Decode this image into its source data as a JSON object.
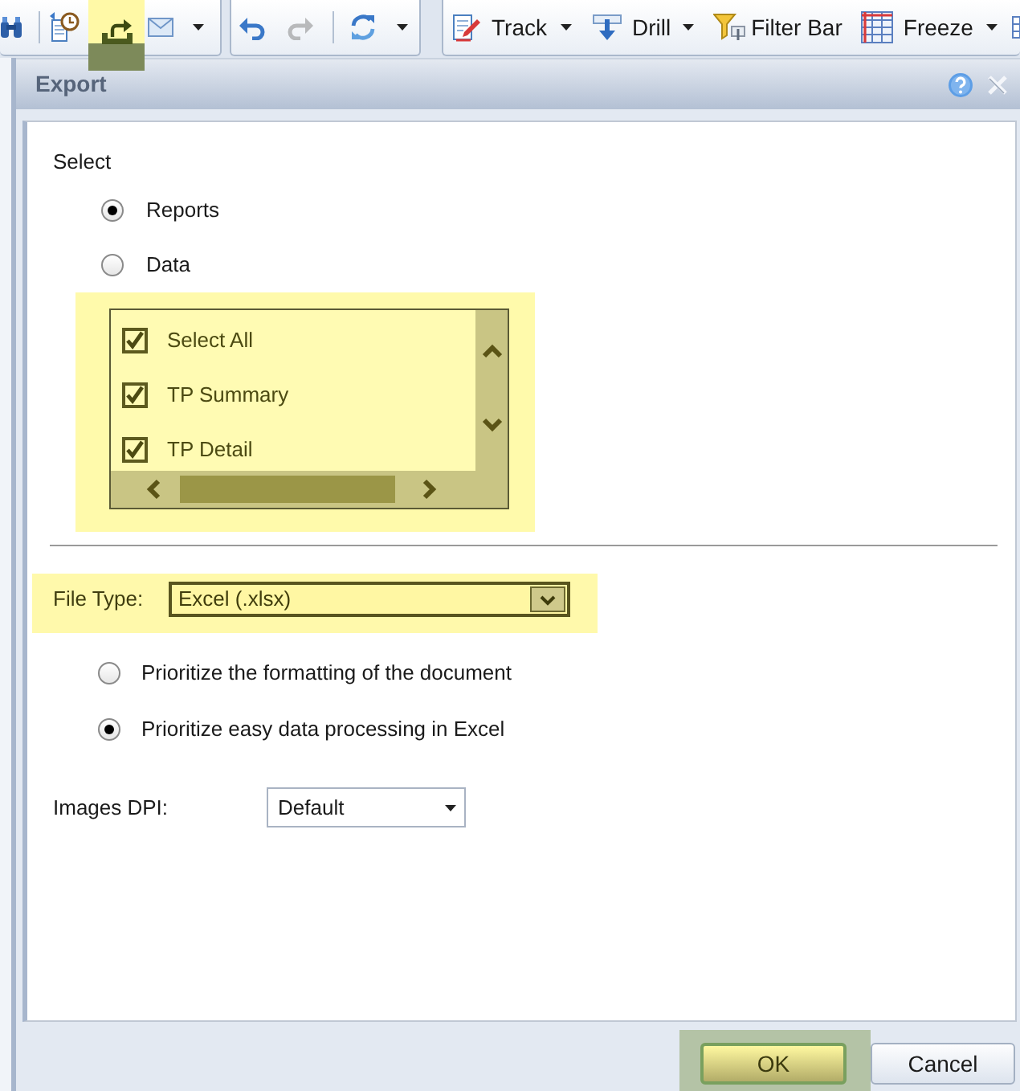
{
  "toolbar": {
    "groups": [
      {
        "buttons": [
          {
            "highlighted": false,
            "disabled": false,
            "dropdown": false
          },
          {
            "highlighted": false,
            "disabled": false,
            "dropdown": false
          },
          {
            "highlighted": true,
            "disabled": false,
            "dropdown": false
          },
          {
            "highlighted": false,
            "disabled": false,
            "dropdown": true
          }
        ]
      },
      {
        "buttons": [
          {
            "highlighted": false,
            "disabled": false,
            "dropdown": false
          },
          {
            "highlighted": false,
            "disabled": true,
            "dropdown": false
          },
          {
            "highlighted": false,
            "disabled": false,
            "dropdown": true
          }
        ]
      },
      {
        "buttons": [
          {
            "label": "Track",
            "highlighted": false,
            "disabled": false,
            "dropdown": true
          },
          {
            "label": "Drill",
            "highlighted": false,
            "disabled": false,
            "dropdown": true
          },
          {
            "label": "Filter Bar",
            "highlighted": false,
            "disabled": false,
            "dropdown": false
          },
          {
            "label": "Freeze",
            "highlighted": false,
            "disabled": false,
            "dropdown": true
          },
          {
            "highlighted": false,
            "disabled": false,
            "dropdown": false
          }
        ]
      }
    ]
  },
  "dialog": {
    "title": "Export",
    "select": {
      "label": "Select",
      "options": [
        {
          "label": "Reports",
          "selected": true
        },
        {
          "label": "Data",
          "selected": false
        }
      ]
    },
    "reports": {
      "highlighted": true,
      "items": [
        {
          "label": "Select All",
          "checked": true
        },
        {
          "label": "TP Summary",
          "checked": true
        },
        {
          "label": "TP Detail",
          "checked": true
        }
      ]
    },
    "file_type": {
      "label": "File Type:",
      "value": "Excel (.xlsx)",
      "highlighted": true
    },
    "format_options": [
      {
        "label": "Prioritize the formatting of the document",
        "selected": false
      },
      {
        "label": "Prioritize easy data processing in Excel",
        "selected": true
      }
    ],
    "images_dpi": {
      "label": "Images DPI:",
      "value": "Default"
    },
    "buttons": [
      {
        "label": "OK",
        "highlighted": true
      },
      {
        "label": "Cancel",
        "highlighted": false
      }
    ]
  }
}
